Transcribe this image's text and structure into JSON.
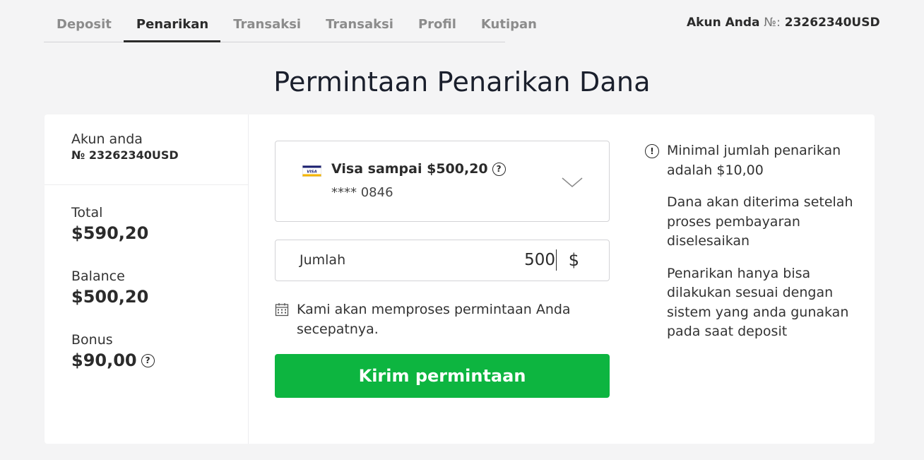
{
  "nav": {
    "tabs": [
      {
        "label": "Deposit"
      },
      {
        "label": "Penarikan"
      },
      {
        "label": "Transaksi"
      },
      {
        "label": "Transaksi"
      },
      {
        "label": "Profil"
      },
      {
        "label": "Kutipan"
      }
    ],
    "active_tab": "Penarikan"
  },
  "account_header": {
    "label": "Akun Anda",
    "number_sign": "№:",
    "number": "23262340USD"
  },
  "page_title": "Permintaan Penarikan Dana",
  "sidebar": {
    "account_label": "Akun anda",
    "account_number": "№ 23262340USD",
    "total_label": "Total",
    "total_value": "$590,20",
    "balance_label": "Balance",
    "balance_value": "$500,20",
    "bonus_label": "Bonus",
    "bonus_value": "$90,00"
  },
  "method": {
    "logo_text": "VISA",
    "title": "Visa sampai $500,20",
    "card_masked": "**** 0846"
  },
  "amount": {
    "label": "Jumlah",
    "value": "500",
    "currency": "$"
  },
  "notice": "Kami akan memproses permintaan Anda secepatnya.",
  "submit_label": "Kirim permintaan",
  "info": {
    "min_amount": "Minimal jumlah penarikan adalah $10,00",
    "funds_received": "Dana akan diterima setelah proses pembayaran diselesaikan",
    "same_system": "Penarikan hanya bisa dilakukan sesuai dengan sistem yang anda gunakan pada saat deposit"
  },
  "colors": {
    "submit_bg": "#0db540",
    "page_bg": "#f4f4f5",
    "text": "#2b2b2b"
  }
}
